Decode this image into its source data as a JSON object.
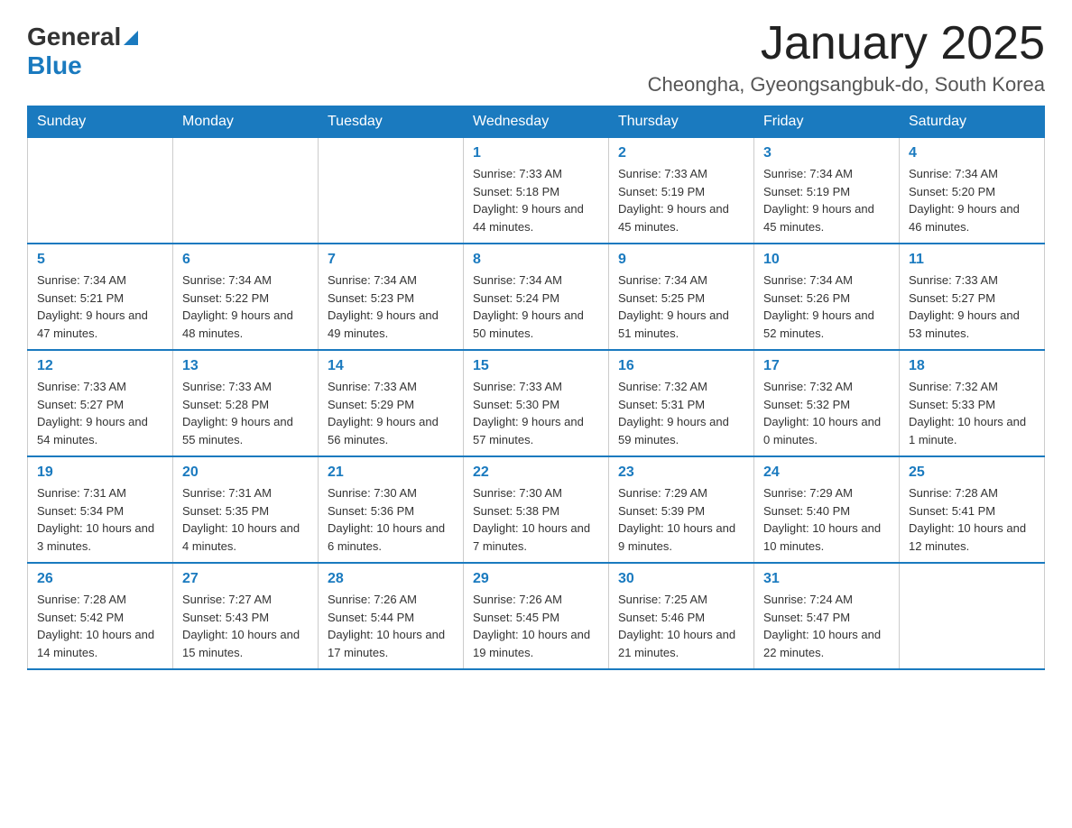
{
  "header": {
    "logo": {
      "general": "General",
      "blue": "Blue",
      "triangle": "▶"
    },
    "title": "January 2025",
    "subtitle": "Cheongha, Gyeongsangbuk-do, South Korea"
  },
  "calendar": {
    "weekdays": [
      "Sunday",
      "Monday",
      "Tuesday",
      "Wednesday",
      "Thursday",
      "Friday",
      "Saturday"
    ],
    "weeks": [
      [
        {
          "day": "",
          "info": ""
        },
        {
          "day": "",
          "info": ""
        },
        {
          "day": "",
          "info": ""
        },
        {
          "day": "1",
          "info": "Sunrise: 7:33 AM\nSunset: 5:18 PM\nDaylight: 9 hours and 44 minutes."
        },
        {
          "day": "2",
          "info": "Sunrise: 7:33 AM\nSunset: 5:19 PM\nDaylight: 9 hours and 45 minutes."
        },
        {
          "day": "3",
          "info": "Sunrise: 7:34 AM\nSunset: 5:19 PM\nDaylight: 9 hours and 45 minutes."
        },
        {
          "day": "4",
          "info": "Sunrise: 7:34 AM\nSunset: 5:20 PM\nDaylight: 9 hours and 46 minutes."
        }
      ],
      [
        {
          "day": "5",
          "info": "Sunrise: 7:34 AM\nSunset: 5:21 PM\nDaylight: 9 hours and 47 minutes."
        },
        {
          "day": "6",
          "info": "Sunrise: 7:34 AM\nSunset: 5:22 PM\nDaylight: 9 hours and 48 minutes."
        },
        {
          "day": "7",
          "info": "Sunrise: 7:34 AM\nSunset: 5:23 PM\nDaylight: 9 hours and 49 minutes."
        },
        {
          "day": "8",
          "info": "Sunrise: 7:34 AM\nSunset: 5:24 PM\nDaylight: 9 hours and 50 minutes."
        },
        {
          "day": "9",
          "info": "Sunrise: 7:34 AM\nSunset: 5:25 PM\nDaylight: 9 hours and 51 minutes."
        },
        {
          "day": "10",
          "info": "Sunrise: 7:34 AM\nSunset: 5:26 PM\nDaylight: 9 hours and 52 minutes."
        },
        {
          "day": "11",
          "info": "Sunrise: 7:33 AM\nSunset: 5:27 PM\nDaylight: 9 hours and 53 minutes."
        }
      ],
      [
        {
          "day": "12",
          "info": "Sunrise: 7:33 AM\nSunset: 5:27 PM\nDaylight: 9 hours and 54 minutes."
        },
        {
          "day": "13",
          "info": "Sunrise: 7:33 AM\nSunset: 5:28 PM\nDaylight: 9 hours and 55 minutes."
        },
        {
          "day": "14",
          "info": "Sunrise: 7:33 AM\nSunset: 5:29 PM\nDaylight: 9 hours and 56 minutes."
        },
        {
          "day": "15",
          "info": "Sunrise: 7:33 AM\nSunset: 5:30 PM\nDaylight: 9 hours and 57 minutes."
        },
        {
          "day": "16",
          "info": "Sunrise: 7:32 AM\nSunset: 5:31 PM\nDaylight: 9 hours and 59 minutes."
        },
        {
          "day": "17",
          "info": "Sunrise: 7:32 AM\nSunset: 5:32 PM\nDaylight: 10 hours and 0 minutes."
        },
        {
          "day": "18",
          "info": "Sunrise: 7:32 AM\nSunset: 5:33 PM\nDaylight: 10 hours and 1 minute."
        }
      ],
      [
        {
          "day": "19",
          "info": "Sunrise: 7:31 AM\nSunset: 5:34 PM\nDaylight: 10 hours and 3 minutes."
        },
        {
          "day": "20",
          "info": "Sunrise: 7:31 AM\nSunset: 5:35 PM\nDaylight: 10 hours and 4 minutes."
        },
        {
          "day": "21",
          "info": "Sunrise: 7:30 AM\nSunset: 5:36 PM\nDaylight: 10 hours and 6 minutes."
        },
        {
          "day": "22",
          "info": "Sunrise: 7:30 AM\nSunset: 5:38 PM\nDaylight: 10 hours and 7 minutes."
        },
        {
          "day": "23",
          "info": "Sunrise: 7:29 AM\nSunset: 5:39 PM\nDaylight: 10 hours and 9 minutes."
        },
        {
          "day": "24",
          "info": "Sunrise: 7:29 AM\nSunset: 5:40 PM\nDaylight: 10 hours and 10 minutes."
        },
        {
          "day": "25",
          "info": "Sunrise: 7:28 AM\nSunset: 5:41 PM\nDaylight: 10 hours and 12 minutes."
        }
      ],
      [
        {
          "day": "26",
          "info": "Sunrise: 7:28 AM\nSunset: 5:42 PM\nDaylight: 10 hours and 14 minutes."
        },
        {
          "day": "27",
          "info": "Sunrise: 7:27 AM\nSunset: 5:43 PM\nDaylight: 10 hours and 15 minutes."
        },
        {
          "day": "28",
          "info": "Sunrise: 7:26 AM\nSunset: 5:44 PM\nDaylight: 10 hours and 17 minutes."
        },
        {
          "day": "29",
          "info": "Sunrise: 7:26 AM\nSunset: 5:45 PM\nDaylight: 10 hours and 19 minutes."
        },
        {
          "day": "30",
          "info": "Sunrise: 7:25 AM\nSunset: 5:46 PM\nDaylight: 10 hours and 21 minutes."
        },
        {
          "day": "31",
          "info": "Sunrise: 7:24 AM\nSunset: 5:47 PM\nDaylight: 10 hours and 22 minutes."
        },
        {
          "day": "",
          "info": ""
        }
      ]
    ]
  }
}
